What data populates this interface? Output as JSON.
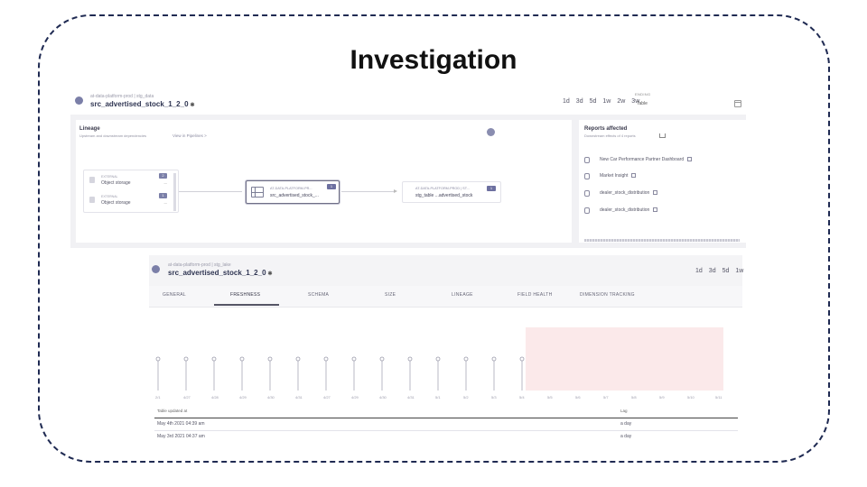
{
  "slide": {
    "title": "Investigation"
  },
  "asset": {
    "breadcrumb": "at-data-platform-prod | stg_data",
    "breadcrumb_lake": "at-data-platform-prod | stg_lake",
    "name": "src_advertised_stock_1_2_0"
  },
  "ranges": [
    "1d",
    "3d",
    "5d",
    "1w",
    "2w",
    "3w"
  ],
  "ranges_short": [
    "1d",
    "3d",
    "5d",
    "1w"
  ],
  "ending": {
    "label": "ENDING",
    "value": "Table"
  },
  "lineage": {
    "title": "Lineage",
    "subtitle": "Upstream and downstream dependencies",
    "link": "View in Pipelines >",
    "external_label": "EXTERNAL",
    "external_name": "Object storage",
    "external_nodes": [
      {
        "label": "EXTERNAL",
        "name": "Object storage",
        "badge": "2",
        "meta": "—"
      },
      {
        "label": "EXTERNAL",
        "name": "Object storage",
        "badge": "1",
        "meta": "—"
      }
    ],
    "main_node": {
      "label": "AT-DATA-PLATFORM-PR...",
      "name": "src_advertised_stock_...",
      "badge": "1"
    },
    "downstream_node": {
      "label": "AT-DATA-PLATFORM-PROD | ST...",
      "name": "stg_table ...advertised_stock",
      "badge": "1"
    }
  },
  "reports": {
    "title": "Reports affected",
    "subtitle": "Downstream effects of 4 reports",
    "items": [
      "New Car Performance Partner Dashboard",
      "Market Insight",
      "dealer_stock_distribution",
      "dealer_stock_distribution"
    ]
  },
  "tabs": [
    "GENERAL",
    "FRESHNESS",
    "SCHEMA",
    "SIZE",
    "LINEAGE",
    "FIELD HEALTH",
    "DIMENSION TRACKING"
  ],
  "active_tab": "FRESHNESS",
  "chart_data": {
    "type": "scatter",
    "x": [
      "2/1",
      "4/27",
      "4/28",
      "4/29",
      "4/30",
      "4/31",
      "4/27",
      "4/29",
      "4/30",
      "4/31",
      "5/1",
      "5/2",
      "5/3",
      "5/4",
      "5/5",
      "5/6",
      "5/7",
      "5/8",
      "5/9",
      "5/10",
      "5/11"
    ],
    "event_indices": [
      0,
      1,
      2,
      3,
      4,
      5,
      6,
      7,
      8,
      9,
      10,
      11,
      12,
      13
    ],
    "anomaly_range": [
      13,
      20
    ],
    "anomaly_color": "#fbe9ea",
    "grid": false
  },
  "table": {
    "headers": [
      "Table updated at",
      "Lag"
    ],
    "rows": [
      {
        "updated": "May 4th 2021 04:39 am",
        "lag": "a day"
      },
      {
        "updated": "May 3rd 2021 04:37 am",
        "lag": "a day"
      }
    ]
  }
}
